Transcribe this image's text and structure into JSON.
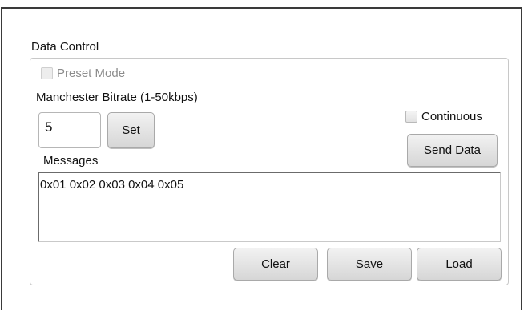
{
  "data_control": {
    "title": "Data Control",
    "preset_mode_label": "Preset Mode",
    "bitrate_label": "Manchester Bitrate (1-50kbps)",
    "bitrate_value": "5",
    "set_label": "Set",
    "continuous_label": "Continuous",
    "send_data_label": "Send Data",
    "messages_label": "Messages",
    "messages_value": "0x01 0x02 0x03 0x04 0x05",
    "clear_label": "Clear",
    "save_label": "Save",
    "load_label": "Load"
  }
}
